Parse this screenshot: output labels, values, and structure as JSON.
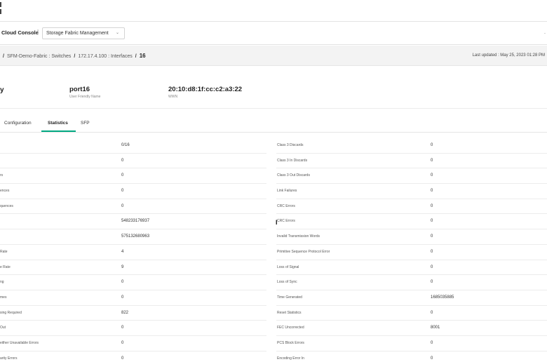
{
  "header": {
    "brand": "Cloud Console",
    "separator": "|",
    "app_selector": "Storage Fabric Management",
    "right_text": "."
  },
  "breadcrumb": {
    "items": [
      "SFM-Demo-Fabric : Switches",
      "172.17.4.100 : Interfaces",
      "16"
    ],
    "last_updated": "Last updated :  May 25, 2023 01:28 PM"
  },
  "summary": {
    "left_fragment": "y",
    "name_value": "port16",
    "name_label": "User Friendly Name",
    "wwn_value": "20:10:d8:1f:cc:c2:a3:22",
    "wwn_label": "WWN"
  },
  "tabs": [
    {
      "label": "Configuration",
      "active": false
    },
    {
      "label": "Statistics",
      "active": true
    },
    {
      "label": "SFP",
      "active": false
    }
  ],
  "stats": {
    "rows": [
      {
        "left_label": "",
        "left_value": "0/16",
        "right_label": "Class 3 Discards",
        "right_value": "0"
      },
      {
        "left_label": "",
        "left_value": "0",
        "right_label": "Class 3 In Discards",
        "right_value": "0"
      },
      {
        "left_label": "rs",
        "left_value": "0",
        "right_label": "Class 3 Out Discards",
        "right_value": "0"
      },
      {
        "left_label": "ences",
        "left_value": "0",
        "right_label": "Link Failures",
        "right_value": "0"
      },
      {
        "left_label": "quences",
        "left_value": "0",
        "right_label": "CRC Errors",
        "right_value": "0"
      },
      {
        "left_label": "",
        "left_value": "548233176937",
        "right_label": "CRC Errors",
        "right_value": "0"
      },
      {
        "left_label": "",
        "left_value": "575132680963",
        "right_label": "Invalid Transmission Words",
        "right_value": "0"
      },
      {
        "left_label": "Rate",
        "left_value": "4",
        "right_label": "Primitive Sequence Protocol Error",
        "right_value": "0"
      },
      {
        "left_label": "e Rate",
        "left_value": "9",
        "right_label": "Loss of Signal",
        "right_value": "0"
      },
      {
        "left_label": "ng",
        "left_value": "0",
        "right_label": "Loss of Sync",
        "right_value": "0"
      },
      {
        "left_label": "mes",
        "left_value": "0",
        "right_label": "Time Generated",
        "right_value": "1685035885"
      },
      {
        "left_label": "sing Required",
        "left_value": "822",
        "right_label": "Reset Statistics",
        "right_value": "0"
      },
      {
        "left_label": "Out",
        "left_value": "0",
        "right_label": "FEC Uncorrected",
        "right_value": "8001"
      },
      {
        "left_label": "either Unavailable Errors",
        "left_value": "0",
        "right_label": "PCS Block Errors",
        "right_value": "0"
      },
      {
        "left_label": "arity Errors",
        "left_value": "0",
        "right_label": "Encoding Error In",
        "right_value": "0"
      }
    ]
  }
}
